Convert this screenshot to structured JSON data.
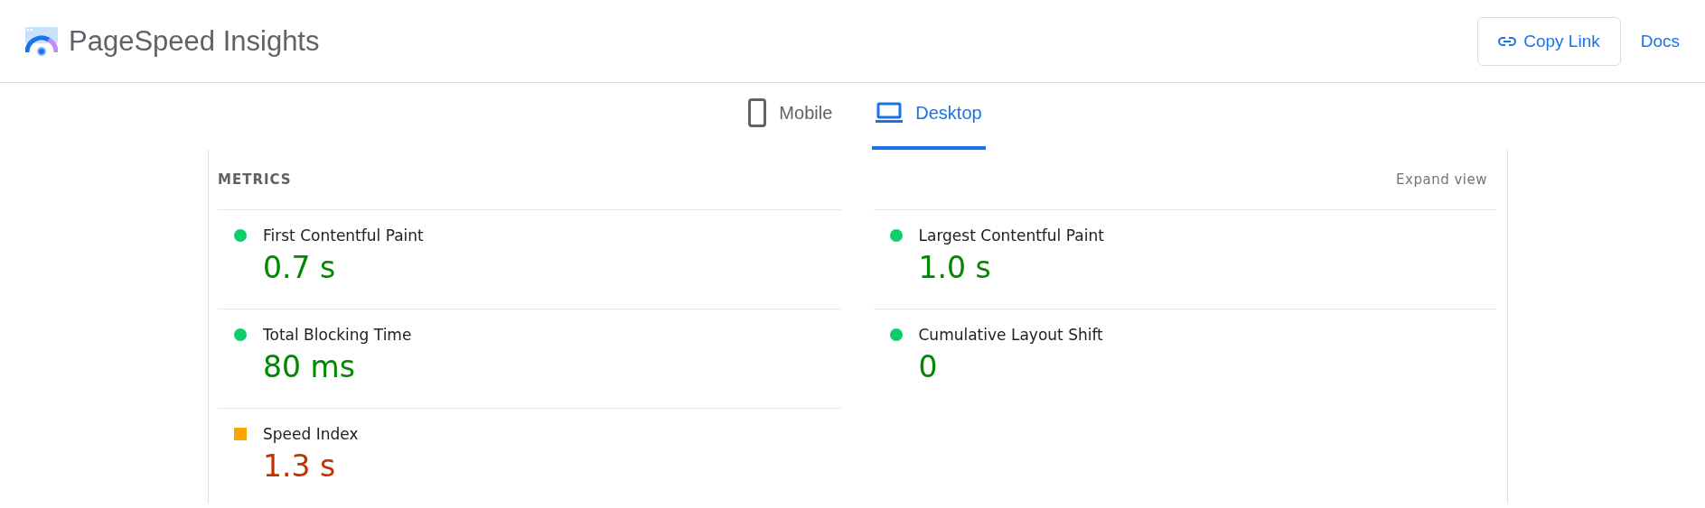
{
  "header": {
    "title": "PageSpeed Insights",
    "copy_link": "Copy Link",
    "docs": "Docs"
  },
  "tabs": [
    {
      "label": "Mobile",
      "kind": "phone",
      "selected": false
    },
    {
      "label": "Desktop",
      "kind": "laptop",
      "selected": true
    }
  ],
  "metrics": {
    "heading": "METRICS",
    "expand": "Expand view",
    "items": [
      {
        "label": "First Contentful Paint",
        "value": "0.7 s",
        "kind": "good"
      },
      {
        "label": "Largest Contentful Paint",
        "value": "1.0 s",
        "kind": "good"
      },
      {
        "label": "Total Blocking Time",
        "value": "80 ms",
        "kind": "good"
      },
      {
        "label": "Cumulative Layout Shift",
        "value": "0",
        "kind": "good"
      },
      {
        "label": "Speed Index",
        "value": "1.3 s",
        "kind": "average"
      }
    ]
  }
}
